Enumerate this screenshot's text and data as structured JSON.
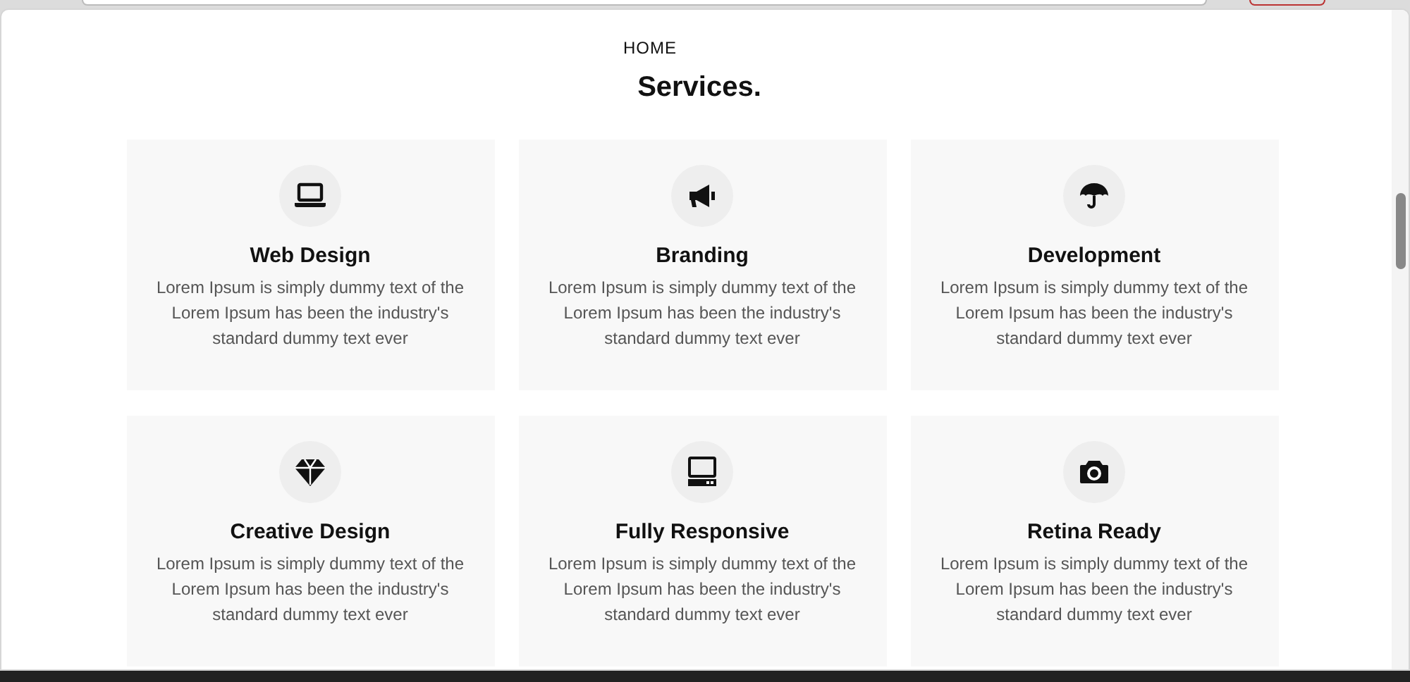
{
  "breadcrumb": "HOME",
  "title": "Services.",
  "services": [
    {
      "name": "Web Design",
      "text": "Lorem Ipsum is simply dummy text of the Lorem Ipsum has been the industry's standard dummy text ever"
    },
    {
      "name": "Branding",
      "text": "Lorem Ipsum is simply dummy text of the Lorem Ipsum has been the industry's standard dummy text ever"
    },
    {
      "name": "Development",
      "text": "Lorem Ipsum is simply dummy text of the Lorem Ipsum has been the industry's standard dummy text ever"
    },
    {
      "name": "Creative Design",
      "text": "Lorem Ipsum is simply dummy text of the Lorem Ipsum has been the industry's standard dummy text ever"
    },
    {
      "name": "Fully Responsive",
      "text": "Lorem Ipsum is simply dummy text of the Lorem Ipsum has been the industry's standard dummy text ever"
    },
    {
      "name": "Retina Ready",
      "text": "Lorem Ipsum is simply dummy text of the Lorem Ipsum has been the industry's standard dummy text ever"
    }
  ]
}
